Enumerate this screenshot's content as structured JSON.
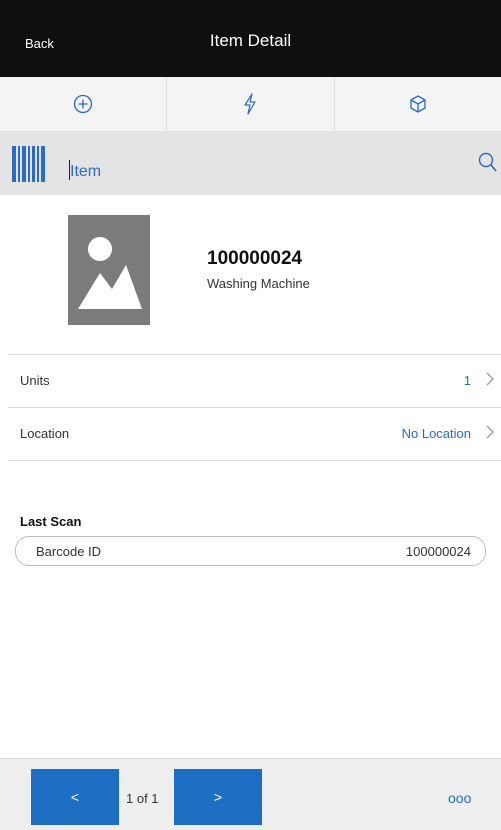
{
  "header": {
    "back_label": "Back",
    "title": "Item Detail"
  },
  "actions": [
    {
      "icon": "plus-circle-icon"
    },
    {
      "icon": "lightning-icon"
    },
    {
      "icon": "cube-icon"
    }
  ],
  "scan": {
    "field_label": "Item",
    "barcode_icon": "barcode-icon",
    "search_icon": "search-icon"
  },
  "item": {
    "number": "100000024",
    "description": "Washing Machine",
    "image_icon": "image-placeholder-icon"
  },
  "rows": [
    {
      "label": "Units",
      "value": "1"
    },
    {
      "label": "Location",
      "value": "No Location"
    }
  ],
  "last_scan": {
    "heading": "Last Scan",
    "key": "Barcode ID",
    "value": "100000024"
  },
  "footer": {
    "prev_label": "<",
    "next_label": ">",
    "page_indicator": "1 of 1",
    "more_label": "ooo"
  },
  "colors": {
    "accent": "#1e6fc4",
    "link": "#2a6cc2",
    "header_bg": "#0f0f0f"
  }
}
